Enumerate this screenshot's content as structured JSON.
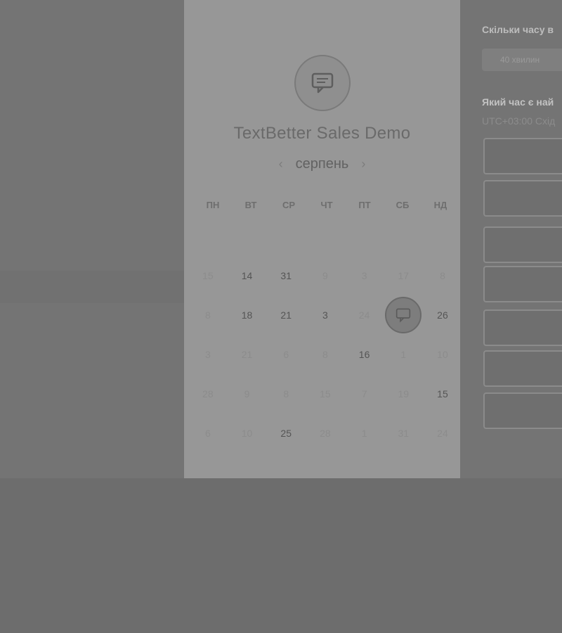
{
  "calendar": {
    "title": "TextBetter Sales Demo",
    "month": "серпень",
    "prev_icon": "chevron-left-icon",
    "next_icon": "chevron-right-icon",
    "weekdays": [
      "ПН",
      "ВТ",
      "СР",
      "ЧТ",
      "ПТ",
      "СБ",
      "НД"
    ],
    "weeks": [
      [
        {
          "d": "15",
          "a": false
        },
        {
          "d": "14",
          "a": true
        },
        {
          "d": "31",
          "a": true
        },
        {
          "d": "9",
          "a": false
        },
        {
          "d": "3",
          "a": false
        },
        {
          "d": "17",
          "a": false
        },
        {
          "d": "8",
          "a": false
        }
      ],
      [
        {
          "d": "8",
          "a": false
        },
        {
          "d": "18",
          "a": true
        },
        {
          "d": "21",
          "a": true
        },
        {
          "d": "3",
          "a": true
        },
        {
          "d": "24",
          "a": false
        },
        {
          "d": "",
          "a": true,
          "s": true
        },
        {
          "d": "26",
          "a": true
        }
      ],
      [
        {
          "d": "3",
          "a": false
        },
        {
          "d": "21",
          "a": false
        },
        {
          "d": "6",
          "a": false
        },
        {
          "d": "8",
          "a": false
        },
        {
          "d": "16",
          "a": true
        },
        {
          "d": "1",
          "a": false
        },
        {
          "d": "10",
          "a": false
        }
      ],
      [
        {
          "d": "28",
          "a": false
        },
        {
          "d": "9",
          "a": false
        },
        {
          "d": "8",
          "a": false
        },
        {
          "d": "15",
          "a": false
        },
        {
          "d": "7",
          "a": false
        },
        {
          "d": "19",
          "a": false
        },
        {
          "d": "15",
          "a": true
        }
      ],
      [
        {
          "d": "6",
          "a": false
        },
        {
          "d": "10",
          "a": false
        },
        {
          "d": "25",
          "a": true
        },
        {
          "d": "28",
          "a": false
        },
        {
          "d": "1",
          "a": false
        },
        {
          "d": "31",
          "a": false
        },
        {
          "d": "24",
          "a": false
        }
      ]
    ]
  },
  "booking": {
    "duration_question": "Скільки часу в",
    "duration_value": "40 хвилин",
    "time_question": "Який час є най",
    "timezone": "UTC+03:00 Схід"
  },
  "colors": {
    "panel": "#979797",
    "overlay": "#737373"
  }
}
